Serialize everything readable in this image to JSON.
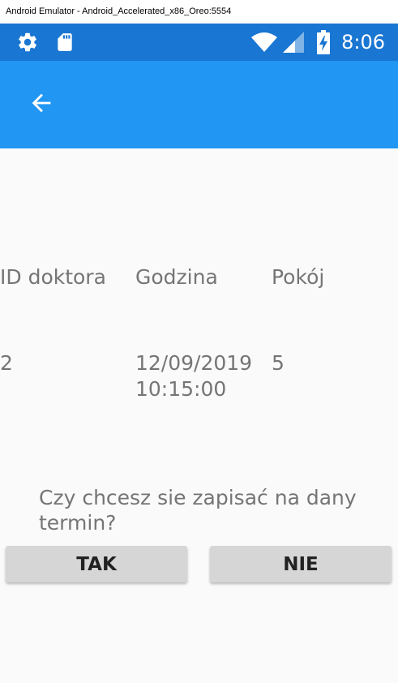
{
  "window": {
    "title": "Android Emulator - Android_Accelerated_x86_Oreo:5554"
  },
  "status_bar": {
    "time": "8:06",
    "icons": [
      "gear-icon",
      "sd-card-icon",
      "wifi-icon",
      "signal-icon",
      "battery-charging-icon"
    ],
    "background": "#1976d2"
  },
  "app_bar": {
    "back_icon": "arrow-left-icon",
    "background": "#2196f3"
  },
  "table": {
    "headers": [
      "ID doktora",
      "Godzina",
      "Pokój"
    ],
    "rows": [
      {
        "id": "2",
        "time_line1": "12/09/2019",
        "time_line2": "10:15:00",
        "room": "5"
      }
    ]
  },
  "prompt": {
    "text": "Czy chcesz sie zapisać na dany termin?"
  },
  "buttons": {
    "yes_label": "TAK",
    "no_label": "NIE"
  }
}
